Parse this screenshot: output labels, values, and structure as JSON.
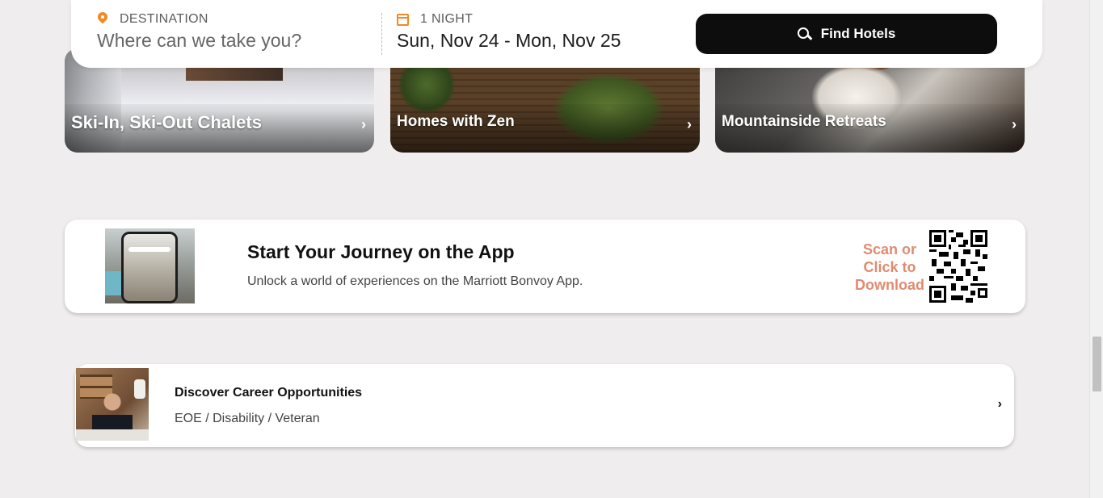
{
  "categories": [
    {
      "label": "Ski-In, Ski-Out Chalets",
      "chevron": "›"
    },
    {
      "label": "Homes with Zen",
      "chevron": "›"
    },
    {
      "label": "Mountainside Retreats",
      "chevron": "›"
    }
  ],
  "search": {
    "destination_label": "DESTINATION",
    "destination_placeholder": "Where can we take you?",
    "dates_label": "1 NIGHT",
    "dates_value": "Sun, Nov 24 - Mon, Nov 25",
    "button_label": "Find Hotels"
  },
  "app_promo": {
    "title": "Start Your Journey on the App",
    "subtitle": "Unlock a world of experiences on the Marriott Bonvoy App.",
    "scan_text": "Scan or Click to Download"
  },
  "careers": {
    "title": "Discover Career Opportunities",
    "subtitle": "EOE / Disability / Veteran",
    "chevron": "›"
  },
  "colors": {
    "accent": "#f08a24",
    "scan_text": "#e08b70",
    "button_bg": "#0d0d0d",
    "page_bg": "#efeded"
  }
}
